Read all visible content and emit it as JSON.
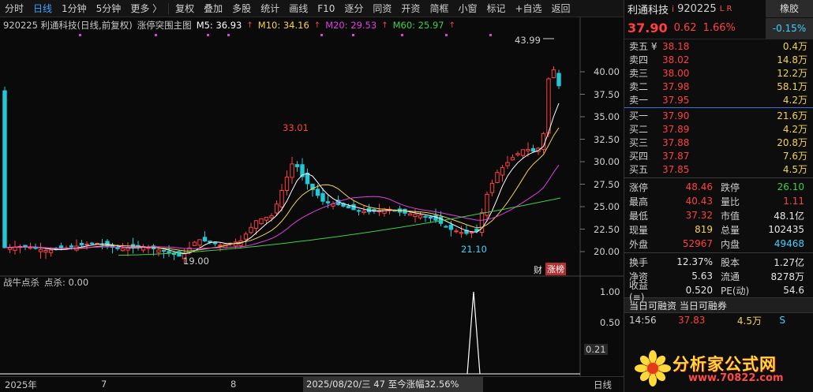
{
  "toolbar": {
    "left_items": [
      "分时",
      "日线",
      "1分钟",
      "5分钟",
      "更多 〉"
    ],
    "right_items": [
      "复权",
      "叠加",
      "多股",
      "统计",
      "画线",
      "F10",
      "逐分",
      "同资",
      "开资",
      "简框",
      "小窗",
      "标记",
      "+自选",
      "返回"
    ]
  },
  "chart": {
    "info": {
      "symbol": "920225 利通科技(日线,前复权)",
      "indicator": "涨停突围主图",
      "m5": "M5: 36.93",
      "m10": "M10: 34.16",
      "m20": "M20: 29.53",
      "m60": "M60: 25.97"
    },
    "price_labels": {
      "high_peak": "33.01",
      "low1": "19.00",
      "low2": "21.10",
      "top": "43.99"
    },
    "y_axis": [
      "40.00",
      "37.50",
      "35.00",
      "32.50",
      "30.00",
      "27.50",
      "25.00",
      "22.50",
      "20.00"
    ],
    "sub": {
      "name": "战牛点杀",
      "value": "点杀: 0.00"
    },
    "sub_axis": [
      "1.00",
      "0.50",
      "0.21"
    ],
    "badge_cai": "财",
    "badge_zb": "涨榜",
    "dates": [
      "2025年",
      "7",
      "8",
      "10",
      "日线"
    ],
    "date_mid": "2025/08/20/三 47 至今涨幅32.56%",
    "colors": {
      "up": "#ff4040",
      "down": "#22c8d8",
      "m5": "#ffffff",
      "m10": "#f5d44a",
      "m20": "#e040e0",
      "m60": "#3ecf4a"
    }
  },
  "panel": {
    "name": "利通科技",
    "name_flag": "i",
    "code": "920225",
    "lr": "L R",
    "tag": "橡胶",
    "price": "37.90",
    "change": "0.62",
    "change_pct": "1.66%",
    "tag_val": "-0.15%",
    "asks": [
      {
        "k": "卖五 ¥",
        "v": "38.18",
        "q": "0.4万"
      },
      {
        "k": "卖四",
        "v": "38.02",
        "q": "14.8万"
      },
      {
        "k": "卖三",
        "v": "38.00",
        "q": "12.2万"
      },
      {
        "k": "卖二",
        "v": "37.98",
        "q": "58.1万"
      },
      {
        "k": "卖一",
        "v": "37.95",
        "q": "4.2万"
      }
    ],
    "bids": [
      {
        "k": "买一",
        "v": "37.90",
        "q": "21.6万"
      },
      {
        "k": "买二",
        "v": "37.89",
        "q": "4.2万"
      },
      {
        "k": "买三",
        "v": "37.88",
        "q": "20.8万"
      },
      {
        "k": "买四",
        "v": "37.87",
        "q": "7.6万"
      },
      {
        "k": "买五",
        "v": "37.85",
        "q": "4.5万"
      }
    ],
    "stats": [
      {
        "k1": "涨停",
        "v1": "48.46",
        "c1": "red",
        "k2": "跌停",
        "v2": "26.10",
        "c2": "green"
      },
      {
        "k1": "最高",
        "v1": "40.43",
        "c1": "red",
        "k2": "量比",
        "v2": "1.11",
        "c2": "red"
      },
      {
        "k1": "最低",
        "v1": "37.32",
        "c1": "red",
        "k2": "市值",
        "v2": "48.1亿",
        "c2": "white"
      },
      {
        "k1": "现量",
        "v1": "819",
        "c1": "yellow",
        "k2": "总量",
        "v2": "102435",
        "c2": "white"
      },
      {
        "k1": "外盘",
        "v1": "52967",
        "c1": "red",
        "k2": "内盘",
        "v2": "49468",
        "c2": "cyan"
      }
    ],
    "stats2": [
      {
        "k1": "换手",
        "v1": "12.37%",
        "c1": "white",
        "k2": "股本",
        "v2": "1.27亿",
        "c2": "white"
      },
      {
        "k1": "净资",
        "v1": "5.63",
        "c1": "white",
        "k2": "流通",
        "v2": "8278万",
        "c2": "white"
      },
      {
        "k1": "收益(≡)",
        "v1": "0.520",
        "c1": "white",
        "k2": "PE(动)",
        "v2": "54.6",
        "c2": "white"
      }
    ],
    "margin_bar": "当日可融资 当日可融券",
    "ticks": [
      {
        "t": "14:56",
        "p": "37.83",
        "q": "4.5万",
        "bs": "S"
      }
    ],
    "watermark_text": "分析家公式网",
    "watermark_url": "www.70822.com"
  }
}
